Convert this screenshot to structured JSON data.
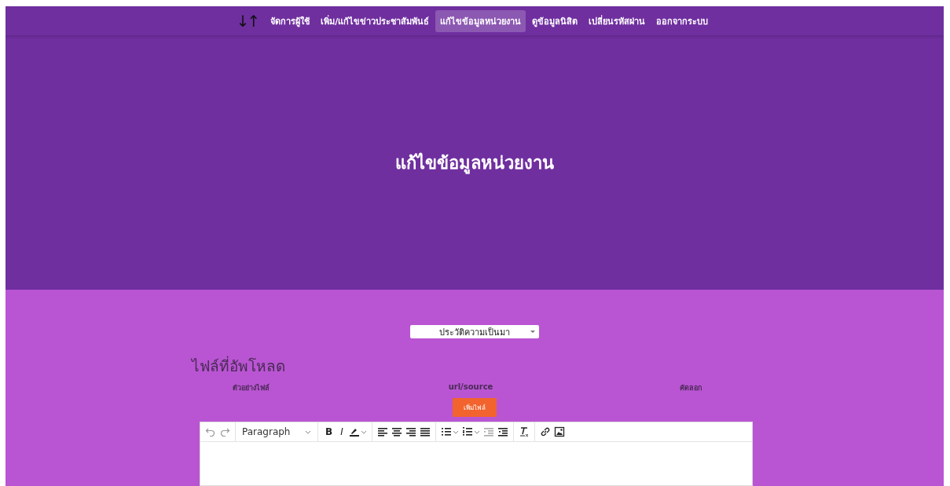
{
  "nav": {
    "logo": "↓↑",
    "items": [
      {
        "label": "จัดการผู้ใช้",
        "selected": false
      },
      {
        "label": "เพิ่ม/แก้ไขข่าวประชาสัมพันธ์",
        "selected": false
      },
      {
        "label": "แก้ไขข้อมูลหน่วยงาน",
        "selected": true
      },
      {
        "label": "ดูข้อมูลนิสิต",
        "selected": false
      },
      {
        "label": "เปลี่ยนรหัสผ่าน",
        "selected": false
      },
      {
        "label": "ออกจากระบบ",
        "selected": false
      }
    ]
  },
  "hero": {
    "title": "แก้ไขข้อมูลหน่วยงาน"
  },
  "section_select": {
    "value": "ประวัติความเป็นมา"
  },
  "uploads": {
    "title": "ไฟล์ที่อัพโหลด",
    "columns": [
      "ตัวอย่างไฟล์",
      "url/source",
      "คัดลอก"
    ],
    "add_button": "เพิ่มไฟล์"
  },
  "editor": {
    "toolbar": [
      {
        "kind": "undo"
      },
      {
        "kind": "redo"
      },
      {
        "kind": "sep"
      },
      {
        "kind": "format",
        "label": "Paragraph"
      },
      {
        "kind": "sep"
      },
      {
        "kind": "bold",
        "label": "B"
      },
      {
        "kind": "italic",
        "label": "I"
      },
      {
        "kind": "highlight"
      },
      {
        "kind": "sep"
      },
      {
        "kind": "align-left"
      },
      {
        "kind": "align-center"
      },
      {
        "kind": "align-right"
      },
      {
        "kind": "align-justify"
      },
      {
        "kind": "sep"
      },
      {
        "kind": "bullets"
      },
      {
        "kind": "numbers"
      },
      {
        "kind": "outdent",
        "disabled": true
      },
      {
        "kind": "indent",
        "disabled": false
      },
      {
        "kind": "sep"
      },
      {
        "kind": "clear"
      },
      {
        "kind": "sep"
      },
      {
        "kind": "link"
      },
      {
        "kind": "image"
      }
    ]
  }
}
